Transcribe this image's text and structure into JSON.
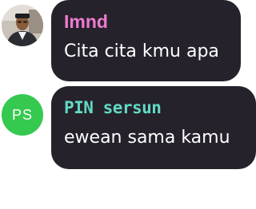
{
  "messages": [
    {
      "sender": "Imnd",
      "text": "Cita cita kmu apa",
      "name_color": "#ee7bd0",
      "avatar": {
        "type": "photo"
      }
    },
    {
      "sender": "PIN sersun",
      "text": "ewean sama kamu",
      "name_color": "#62d9c4",
      "avatar": {
        "type": "initials",
        "initials": "PS",
        "color": "#35c94f"
      }
    }
  ],
  "colors": {
    "bubble": "#25222b",
    "background": "#ffffff",
    "text": "#ffffff"
  }
}
